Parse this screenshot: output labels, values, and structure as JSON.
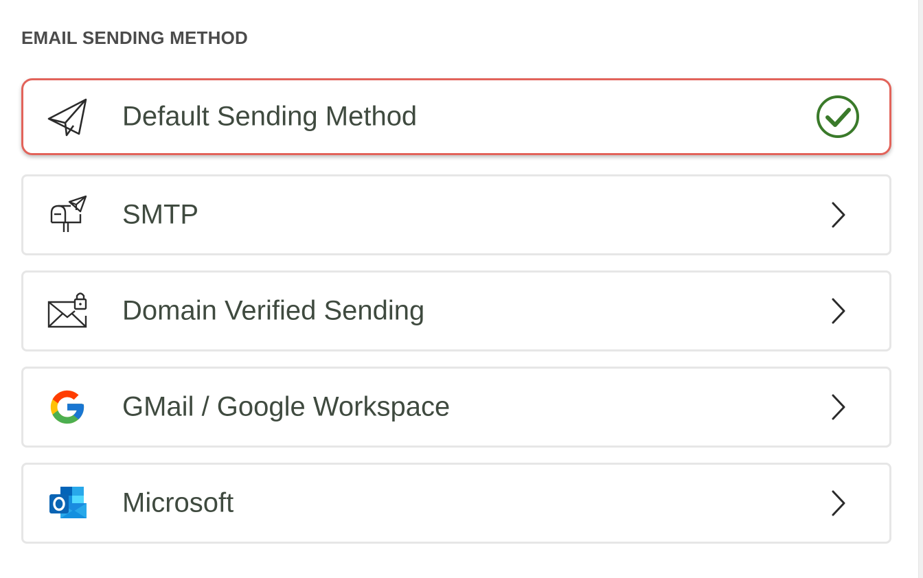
{
  "section": {
    "title": "EMAIL SENDING METHOD"
  },
  "methods": [
    {
      "label": "Default Sending Method",
      "icon": "paper-plane-icon",
      "selected": true
    },
    {
      "label": "SMTP",
      "icon": "mailbox-icon",
      "selected": false
    },
    {
      "label": "Domain Verified Sending",
      "icon": "envelope-lock-icon",
      "selected": false
    },
    {
      "label": "GMail / Google Workspace",
      "icon": "google-logo-icon",
      "selected": false
    },
    {
      "label": "Microsoft",
      "icon": "outlook-logo-icon",
      "selected": false
    }
  ],
  "colors": {
    "selected_border": "#e2635a",
    "check": "#3a7a2a",
    "text": "#3f4a3f"
  }
}
